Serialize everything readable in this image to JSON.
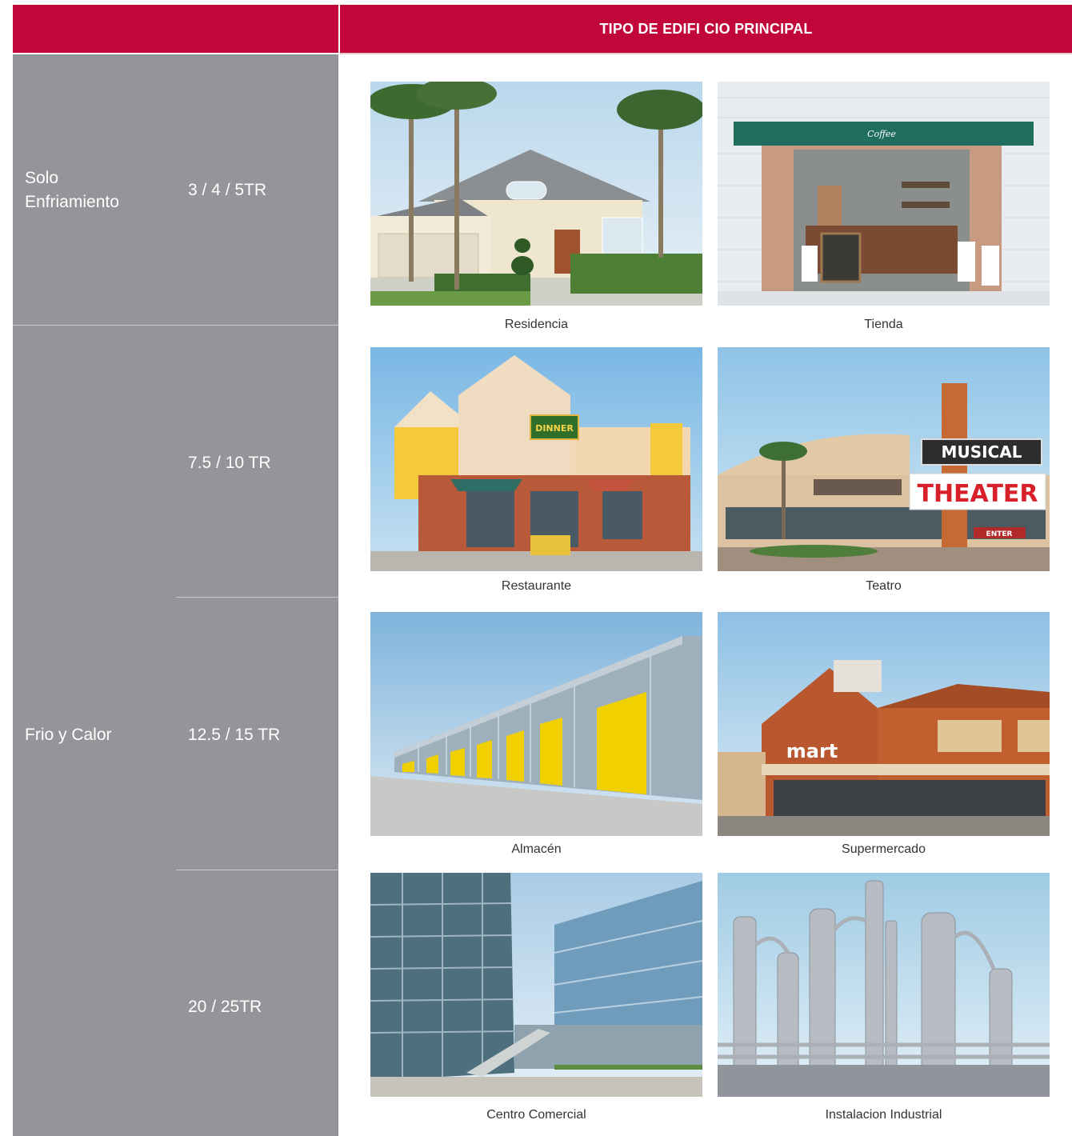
{
  "header": {
    "title": "TIPO DE EDIFI CIO PRINCIPAL"
  },
  "rows": {
    "cooling": {
      "label_line1": "Solo",
      "label_line2": "Enfriamiento",
      "capacity": "3 / 4 / 5TR"
    },
    "heatpump": {
      "label": "Frio y Calor",
      "capacities": [
        "7.5 / 10 TR",
        "12.5 / 15 TR",
        "20 / 25TR"
      ]
    }
  },
  "buildings": [
    {
      "caption": "Residencia"
    },
    {
      "caption": "Tienda",
      "sign": "Coffee"
    },
    {
      "caption": "Restaurante",
      "sign": "DINNER"
    },
    {
      "caption": "Teatro",
      "sign_line1": "MUSICAL",
      "sign_line2": "THEATER",
      "sign_line3": "ENTER"
    },
    {
      "caption": "Almacén"
    },
    {
      "caption": "Supermercado",
      "sign": "mart"
    },
    {
      "caption": "Centro Comercial"
    },
    {
      "caption": "Instalacion Industrial"
    }
  ],
  "colors": {
    "header": "#c1063a",
    "left_column": "#939598",
    "caption_text": "#333333"
  }
}
